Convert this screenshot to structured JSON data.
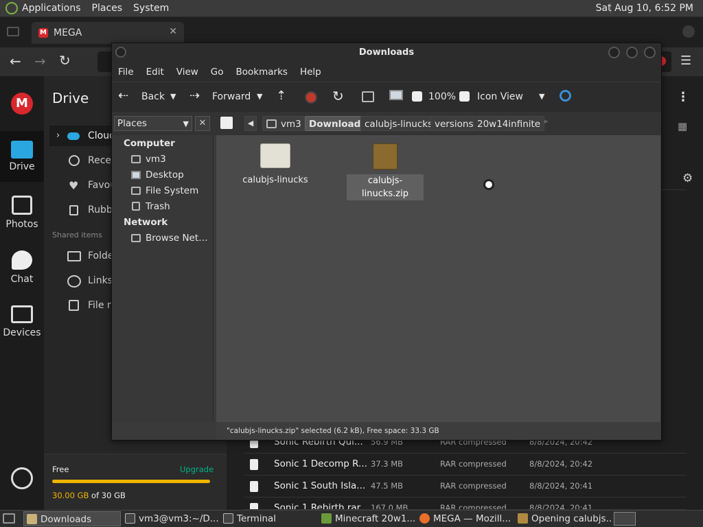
{
  "top_panel": {
    "menus": [
      "Applications",
      "Places",
      "System"
    ],
    "clock": "Sat Aug 10,  6:52 PM"
  },
  "browser": {
    "tab_title": "MEGA"
  },
  "mega": {
    "sidebar": [
      {
        "label": "Drive",
        "icon": "folder-icon"
      },
      {
        "label": "Photos",
        "icon": "photos-icon"
      },
      {
        "label": "Chat",
        "icon": "chat-icon"
      },
      {
        "label": "Devices",
        "icon": "devices-icon"
      }
    ],
    "drive_title": "Drive",
    "nav": [
      {
        "label": "Cloud",
        "icon": "cloud-icon"
      },
      {
        "label": "Recen",
        "icon": "clock-icon"
      },
      {
        "label": "Favou",
        "icon": "heart-icon"
      },
      {
        "label": "Rubb",
        "icon": "trash-icon"
      }
    ],
    "shared_items_label": "Shared items",
    "shared": [
      {
        "label": "Folde",
        "icon": "folder-share-icon"
      },
      {
        "label": "Links",
        "icon": "link-icon"
      },
      {
        "label": "File r",
        "icon": "file-request-icon"
      }
    ],
    "storage": {
      "plan": "Free",
      "upgrade": "Upgrade",
      "used_text": "30.00 GB",
      "of_text": " of 30 GB",
      "fraction": 1.0
    },
    "files": [
      {
        "name": "Sonic Rebirth Qui...",
        "size": "56.9 MB",
        "type": "RAR compressed",
        "date": "8/8/2024, 20:42"
      },
      {
        "name": "Sonic 1 Decomp R...",
        "size": "37.3 MB",
        "type": "RAR compressed",
        "date": "8/8/2024, 20:42"
      },
      {
        "name": "Sonic 1 South Isla...",
        "size": "47.5 MB",
        "type": "RAR compressed",
        "date": "8/8/2024, 20:41"
      },
      {
        "name": "Sonic 1 Rebirth rar",
        "size": "167.0 MB",
        "type": "RAR compressed",
        "date": "8/8/2024, 20:41"
      }
    ]
  },
  "file_manager": {
    "title": "Downloads",
    "menu": [
      "File",
      "Edit",
      "View",
      "Go",
      "Bookmarks",
      "Help"
    ],
    "toolbar": {
      "back": "Back",
      "forward": "Forward",
      "zoom": "100%",
      "view_mode": "Icon View"
    },
    "breadcrumbs": [
      "vm3",
      "Downloads",
      "calubjs-linucks",
      "versions",
      "20w14infinite"
    ],
    "active_crumb": "Downloads",
    "places_selector": "Places",
    "places": {
      "computer_header": "Computer",
      "computer_items": [
        {
          "label": "vm3",
          "icon": "home-icon"
        },
        {
          "label": "Desktop",
          "icon": "desktop-icon"
        },
        {
          "label": "File System",
          "icon": "drive-icon"
        },
        {
          "label": "Trash",
          "icon": "trash-icon"
        }
      ],
      "network_header": "Network",
      "network_items": [
        {
          "label": "Browse Net…",
          "icon": "network-icon"
        }
      ]
    },
    "files": [
      {
        "name": "calubjs-linucks",
        "kind": "folder"
      },
      {
        "name": "calubjs-linucks.zip",
        "kind": "archive",
        "selected": true
      }
    ],
    "status": "\"calubjs-linucks.zip\" selected (6.2 kB), Free space: 33.3 GB"
  },
  "taskbar": {
    "items": [
      {
        "label": "Downloads",
        "icon": "folder-icon",
        "color": "#c9b27a"
      },
      {
        "label": "vm3@vm3:~/D...",
        "icon": "terminal-icon",
        "color": "#444444"
      },
      {
        "label": "Terminal",
        "icon": "terminal-icon",
        "color": "#444444"
      },
      {
        "label": "Minecraft 20w1...",
        "icon": "minecraft-icon",
        "color": "#6a9a3a"
      },
      {
        "label": "MEGA — Mozill...",
        "icon": "firefox-icon",
        "color": "#e8702a"
      },
      {
        "label": "Opening calubjs...",
        "icon": "archive-icon",
        "color": "#b08a40"
      }
    ]
  },
  "colors": {
    "mega_red": "#d9272e",
    "accent_green": "#00b388",
    "storage_bar": "#f0b400",
    "record_red": "#c0392b"
  }
}
